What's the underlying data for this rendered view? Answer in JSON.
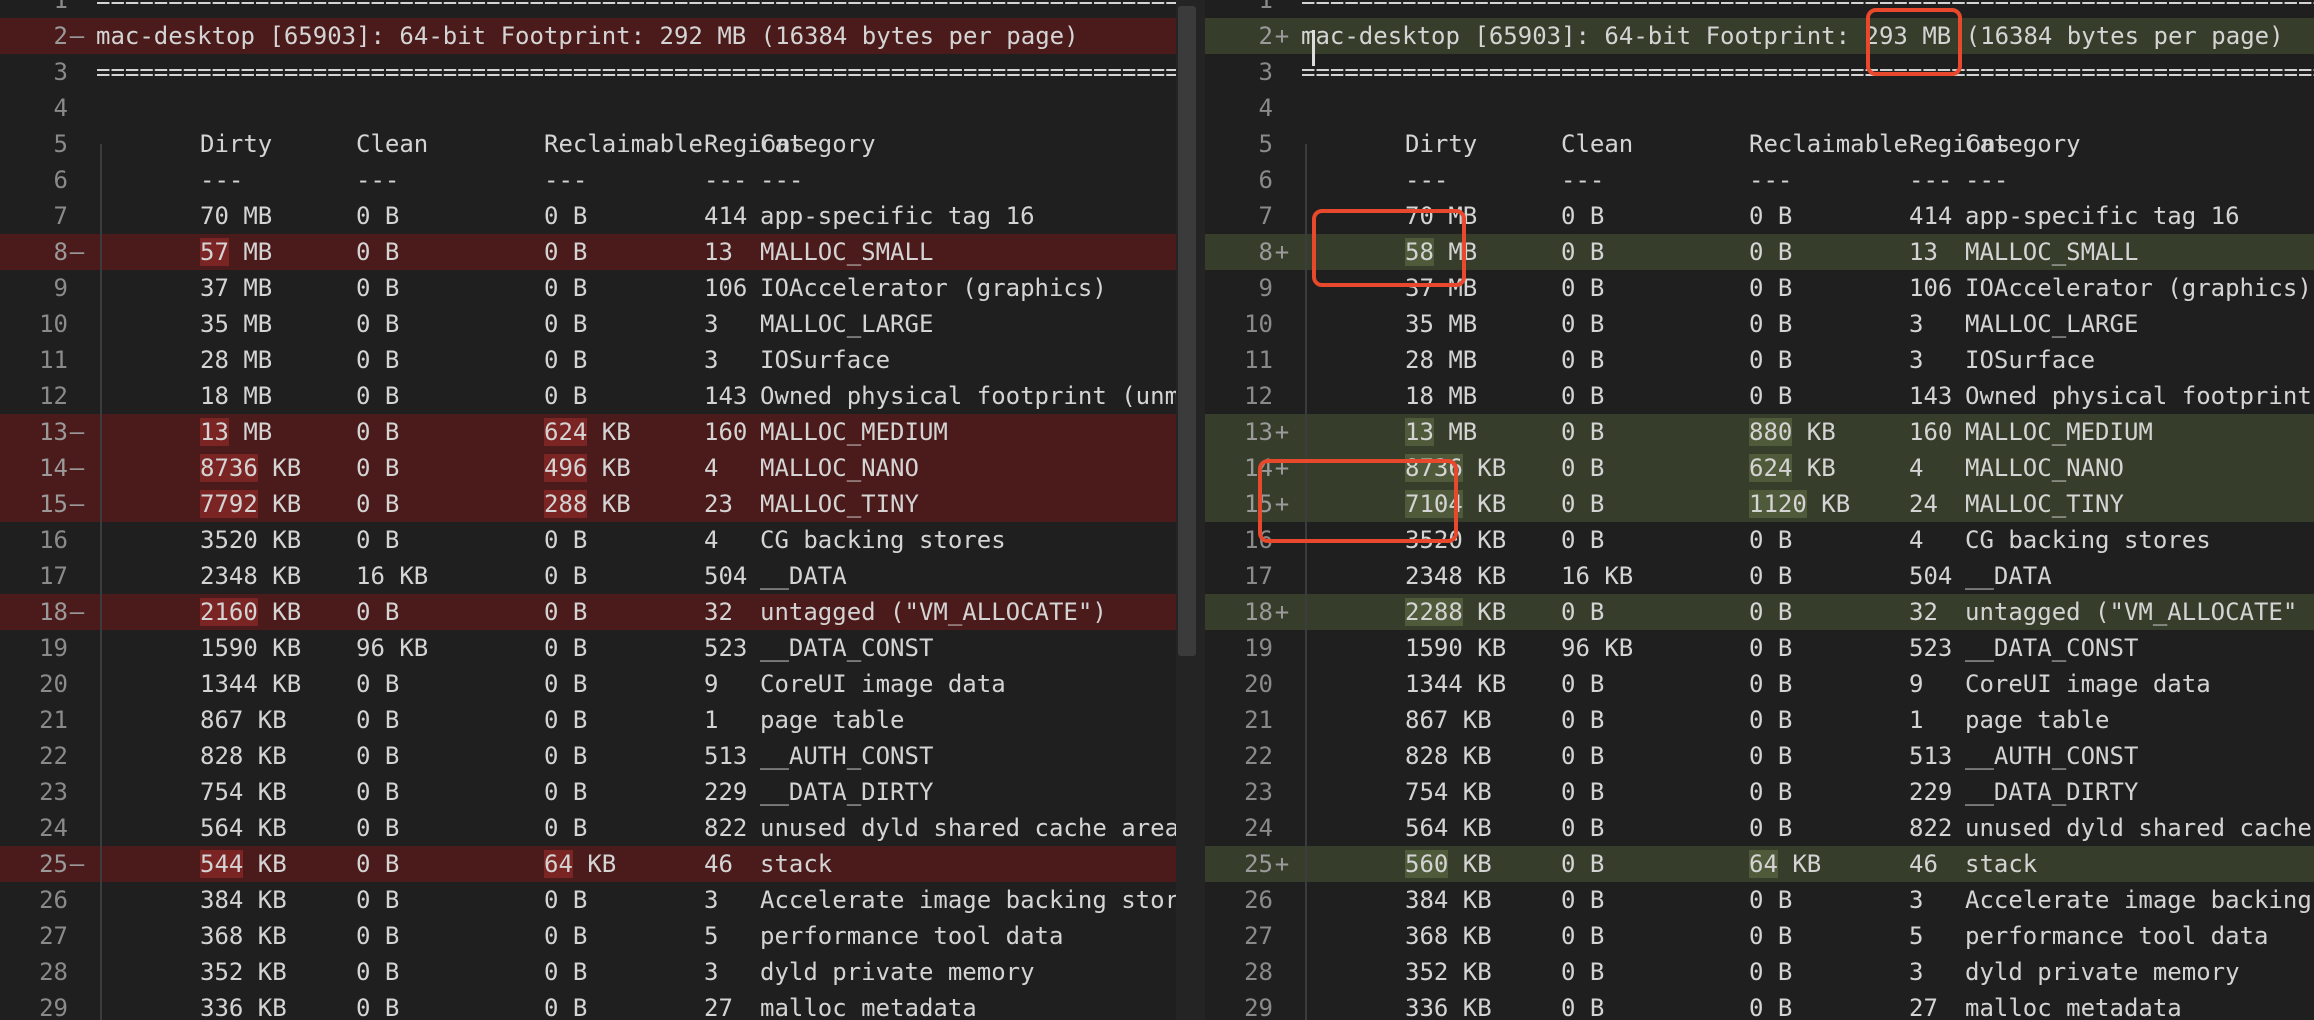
{
  "columns": {
    "dirty": "Dirty",
    "clean": "Clean",
    "reclaimable": "Reclaimable",
    "regions": "Regions",
    "category": "Category"
  },
  "separator": "=============================================================================",
  "dashes": "---",
  "left": {
    "header_text": "mac-desktop [65903]: 64-bit Footprint: 292 MB (16384 bytes per page)",
    "rows": [
      {
        "n": "7",
        "m": "",
        "st": "",
        "dirty": "70 MB",
        "clean": "0 B",
        "recl": "0 B",
        "regions": "414",
        "cat": "app-specific tag 16"
      },
      {
        "n": "8",
        "m": "—",
        "st": "del",
        "dirty": "57 MB",
        "clean": "0 B",
        "recl": "0 B",
        "regions": "13",
        "cat": "MALLOC_SMALL"
      },
      {
        "n": "9",
        "m": "",
        "st": "",
        "dirty": "37 MB",
        "clean": "0 B",
        "recl": "0 B",
        "regions": "106",
        "cat": "IOAccelerator (graphics)"
      },
      {
        "n": "10",
        "m": "",
        "st": "",
        "dirty": "35 MB",
        "clean": "0 B",
        "recl": "0 B",
        "regions": "3",
        "cat": "MALLOC_LARGE"
      },
      {
        "n": "11",
        "m": "",
        "st": "",
        "dirty": "28 MB",
        "clean": "0 B",
        "recl": "0 B",
        "regions": "3",
        "cat": "IOSurface"
      },
      {
        "n": "12",
        "m": "",
        "st": "",
        "dirty": "18 MB",
        "clean": "0 B",
        "recl": "0 B",
        "regions": "143",
        "cat": "Owned physical footprint (unmap"
      },
      {
        "n": "13",
        "m": "—",
        "st": "del",
        "dirty": "13 MB",
        "clean": "0 B",
        "recl": "624 KB",
        "regions": "160",
        "cat": "MALLOC_MEDIUM"
      },
      {
        "n": "14",
        "m": "—",
        "st": "del",
        "dirty": "8736 KB",
        "clean": "0 B",
        "recl": "496 KB",
        "regions": "4",
        "cat": "MALLOC_NANO"
      },
      {
        "n": "15",
        "m": "—",
        "st": "del",
        "dirty": "7792 KB",
        "clean": "0 B",
        "recl": "288 KB",
        "regions": "23",
        "cat": "MALLOC_TINY"
      },
      {
        "n": "16",
        "m": "",
        "st": "",
        "dirty": "3520 KB",
        "clean": "0 B",
        "recl": "0 B",
        "regions": "4",
        "cat": "CG backing stores"
      },
      {
        "n": "17",
        "m": "",
        "st": "",
        "dirty": "2348 KB",
        "clean": "16 KB",
        "recl": "0 B",
        "regions": "504",
        "cat": "__DATA"
      },
      {
        "n": "18",
        "m": "—",
        "st": "del",
        "dirty": "2160 KB",
        "clean": "0 B",
        "recl": "0 B",
        "regions": "32",
        "cat": "untagged (\"VM_ALLOCATE\")"
      },
      {
        "n": "19",
        "m": "",
        "st": "",
        "dirty": "1590 KB",
        "clean": "96 KB",
        "recl": "0 B",
        "regions": "523",
        "cat": "__DATA_CONST"
      },
      {
        "n": "20",
        "m": "",
        "st": "",
        "dirty": "1344 KB",
        "clean": "0 B",
        "recl": "0 B",
        "regions": "9",
        "cat": "CoreUI image data"
      },
      {
        "n": "21",
        "m": "",
        "st": "",
        "dirty": "867 KB",
        "clean": "0 B",
        "recl": "0 B",
        "regions": "1",
        "cat": "page table"
      },
      {
        "n": "22",
        "m": "",
        "st": "",
        "dirty": "828 KB",
        "clean": "0 B",
        "recl": "0 B",
        "regions": "513",
        "cat": "__AUTH_CONST"
      },
      {
        "n": "23",
        "m": "",
        "st": "",
        "dirty": "754 KB",
        "clean": "0 B",
        "recl": "0 B",
        "regions": "229",
        "cat": "__DATA_DIRTY"
      },
      {
        "n": "24",
        "m": "",
        "st": "",
        "dirty": "564 KB",
        "clean": "0 B",
        "recl": "0 B",
        "regions": "822",
        "cat": "unused dyld shared cache area"
      },
      {
        "n": "25",
        "m": "—",
        "st": "del",
        "dirty": "544 KB",
        "clean": "0 B",
        "recl": "64 KB",
        "regions": "46",
        "cat": "stack"
      },
      {
        "n": "26",
        "m": "",
        "st": "",
        "dirty": "384 KB",
        "clean": "0 B",
        "recl": "0 B",
        "regions": "3",
        "cat": "Accelerate image backing stores"
      },
      {
        "n": "27",
        "m": "",
        "st": "",
        "dirty": "368 KB",
        "clean": "0 B",
        "recl": "0 B",
        "regions": "5",
        "cat": "performance tool data"
      },
      {
        "n": "28",
        "m": "",
        "st": "",
        "dirty": "352 KB",
        "clean": "0 B",
        "recl": "0 B",
        "regions": "3",
        "cat": "dyld private memory"
      },
      {
        "n": "29",
        "m": "",
        "st": "",
        "dirty": "336 KB",
        "clean": "0 B",
        "recl": "0 B",
        "regions": "27",
        "cat": "malloc metadata"
      }
    ]
  },
  "right": {
    "header_text": "mac-desktop [65903]: 64-bit Footprint: 293 MB (16384 bytes per page)",
    "rows": [
      {
        "n": "7",
        "m": "",
        "st": "",
        "dirty": "70 MB",
        "clean": "0 B",
        "recl": "0 B",
        "regions": "414",
        "cat": "app-specific tag 16"
      },
      {
        "n": "8",
        "m": "+",
        "st": "add",
        "dirty": "58 MB",
        "clean": "0 B",
        "recl": "0 B",
        "regions": "13",
        "cat": "MALLOC_SMALL"
      },
      {
        "n": "9",
        "m": "",
        "st": "",
        "dirty": "37 MB",
        "clean": "0 B",
        "recl": "0 B",
        "regions": "106",
        "cat": "IOAccelerator (graphics)"
      },
      {
        "n": "10",
        "m": "",
        "st": "",
        "dirty": "35 MB",
        "clean": "0 B",
        "recl": "0 B",
        "regions": "3",
        "cat": "MALLOC_LARGE"
      },
      {
        "n": "11",
        "m": "",
        "st": "",
        "dirty": "28 MB",
        "clean": "0 B",
        "recl": "0 B",
        "regions": "3",
        "cat": "IOSurface"
      },
      {
        "n": "12",
        "m": "",
        "st": "",
        "dirty": "18 MB",
        "clean": "0 B",
        "recl": "0 B",
        "regions": "143",
        "cat": "Owned physical footprint"
      },
      {
        "n": "13",
        "m": "+",
        "st": "add",
        "dirty": "13 MB",
        "clean": "0 B",
        "recl": "880 KB",
        "regions": "160",
        "cat": "MALLOC_MEDIUM"
      },
      {
        "n": "14",
        "m": "+",
        "st": "add",
        "dirty": "8736 KB",
        "clean": "0 B",
        "recl": "624 KB",
        "regions": "4",
        "cat": "MALLOC_NANO"
      },
      {
        "n": "15",
        "m": "+",
        "st": "add",
        "dirty": "7104 KB",
        "clean": "0 B",
        "recl": "1120 KB",
        "regions": "24",
        "cat": "MALLOC_TINY"
      },
      {
        "n": "16",
        "m": "",
        "st": "",
        "dirty": "3520 KB",
        "clean": "0 B",
        "recl": "0 B",
        "regions": "4",
        "cat": "CG backing stores"
      },
      {
        "n": "17",
        "m": "",
        "st": "",
        "dirty": "2348 KB",
        "clean": "16 KB",
        "recl": "0 B",
        "regions": "504",
        "cat": "__DATA"
      },
      {
        "n": "18",
        "m": "+",
        "st": "add",
        "dirty": "2288 KB",
        "clean": "0 B",
        "recl": "0 B",
        "regions": "32",
        "cat": "untagged (\"VM_ALLOCATE\""
      },
      {
        "n": "19",
        "m": "",
        "st": "",
        "dirty": "1590 KB",
        "clean": "96 KB",
        "recl": "0 B",
        "regions": "523",
        "cat": "__DATA_CONST"
      },
      {
        "n": "20",
        "m": "",
        "st": "",
        "dirty": "1344 KB",
        "clean": "0 B",
        "recl": "0 B",
        "regions": "9",
        "cat": "CoreUI image data"
      },
      {
        "n": "21",
        "m": "",
        "st": "",
        "dirty": "867 KB",
        "clean": "0 B",
        "recl": "0 B",
        "regions": "1",
        "cat": "page table"
      },
      {
        "n": "22",
        "m": "",
        "st": "",
        "dirty": "828 KB",
        "clean": "0 B",
        "recl": "0 B",
        "regions": "513",
        "cat": "__AUTH_CONST"
      },
      {
        "n": "23",
        "m": "",
        "st": "",
        "dirty": "754 KB",
        "clean": "0 B",
        "recl": "0 B",
        "regions": "229",
        "cat": "__DATA_DIRTY"
      },
      {
        "n": "24",
        "m": "",
        "st": "",
        "dirty": "564 KB",
        "clean": "0 B",
        "recl": "0 B",
        "regions": "822",
        "cat": "unused dyld shared cache"
      },
      {
        "n": "25",
        "m": "+",
        "st": "add",
        "dirty": "560 KB",
        "clean": "0 B",
        "recl": "64 KB",
        "regions": "46",
        "cat": "stack"
      },
      {
        "n": "26",
        "m": "",
        "st": "",
        "dirty": "384 KB",
        "clean": "0 B",
        "recl": "0 B",
        "regions": "3",
        "cat": "Accelerate image backing"
      },
      {
        "n": "27",
        "m": "",
        "st": "",
        "dirty": "368 KB",
        "clean": "0 B",
        "recl": "0 B",
        "regions": "5",
        "cat": "performance tool data"
      },
      {
        "n": "28",
        "m": "",
        "st": "",
        "dirty": "352 KB",
        "clean": "0 B",
        "recl": "0 B",
        "regions": "3",
        "cat": "dyld private memory"
      },
      {
        "n": "29",
        "m": "",
        "st": "",
        "dirty": "336 KB",
        "clean": "0 B",
        "recl": "0 B",
        "regions": "27",
        "cat": "malloc metadata"
      }
    ]
  },
  "colors": {
    "background": "#1f1f1f",
    "deleted_line": "#4b1a1a",
    "added_line": "#363e2b",
    "callout": "#e8482c"
  }
}
